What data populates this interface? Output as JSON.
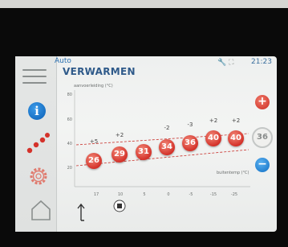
{
  "header": {
    "mode": "Auto",
    "title": "VERWARMEN",
    "status_icons": "🔧 ⛶",
    "clock": "21:23"
  },
  "chart": {
    "y_axis_label": "aanvoerleiding (°C)",
    "x_axis_label": "buitentemp (°C)",
    "y_ticks": [
      "80",
      "60",
      "40",
      "20"
    ],
    "x_ticks": [
      "17",
      "10",
      "5",
      "0",
      "-5",
      "-15",
      "-25"
    ]
  },
  "chart_data": {
    "type": "line",
    "points": [
      {
        "value": "26",
        "offset": "+5"
      },
      {
        "value": "29",
        "offset": "+2"
      },
      {
        "value": "31",
        "offset": ""
      },
      {
        "value": "34",
        "offset": "-2"
      },
      {
        "value": "36",
        "offset": "-3"
      },
      {
        "value": "40",
        "offset": "+2"
      },
      {
        "value": "40",
        "offset": "+2"
      }
    ]
  },
  "controls": {
    "plus": "+",
    "minus": "−",
    "setpoint": "36"
  },
  "sidebar": {
    "info": "i"
  },
  "colors": {
    "point_red": "#d4322a",
    "plus_red": "#cc2b22",
    "minus_blue": "#0f6fc4",
    "info_blue": "#0a5fb5",
    "title_blue": "#2f5a8a"
  },
  "icons": [
    "menu-icon",
    "info-icon",
    "heating-curve-icon",
    "settings-gear-icon",
    "home-icon",
    "arrow-up-icon",
    "pump-icon",
    "wrench-icon"
  ]
}
